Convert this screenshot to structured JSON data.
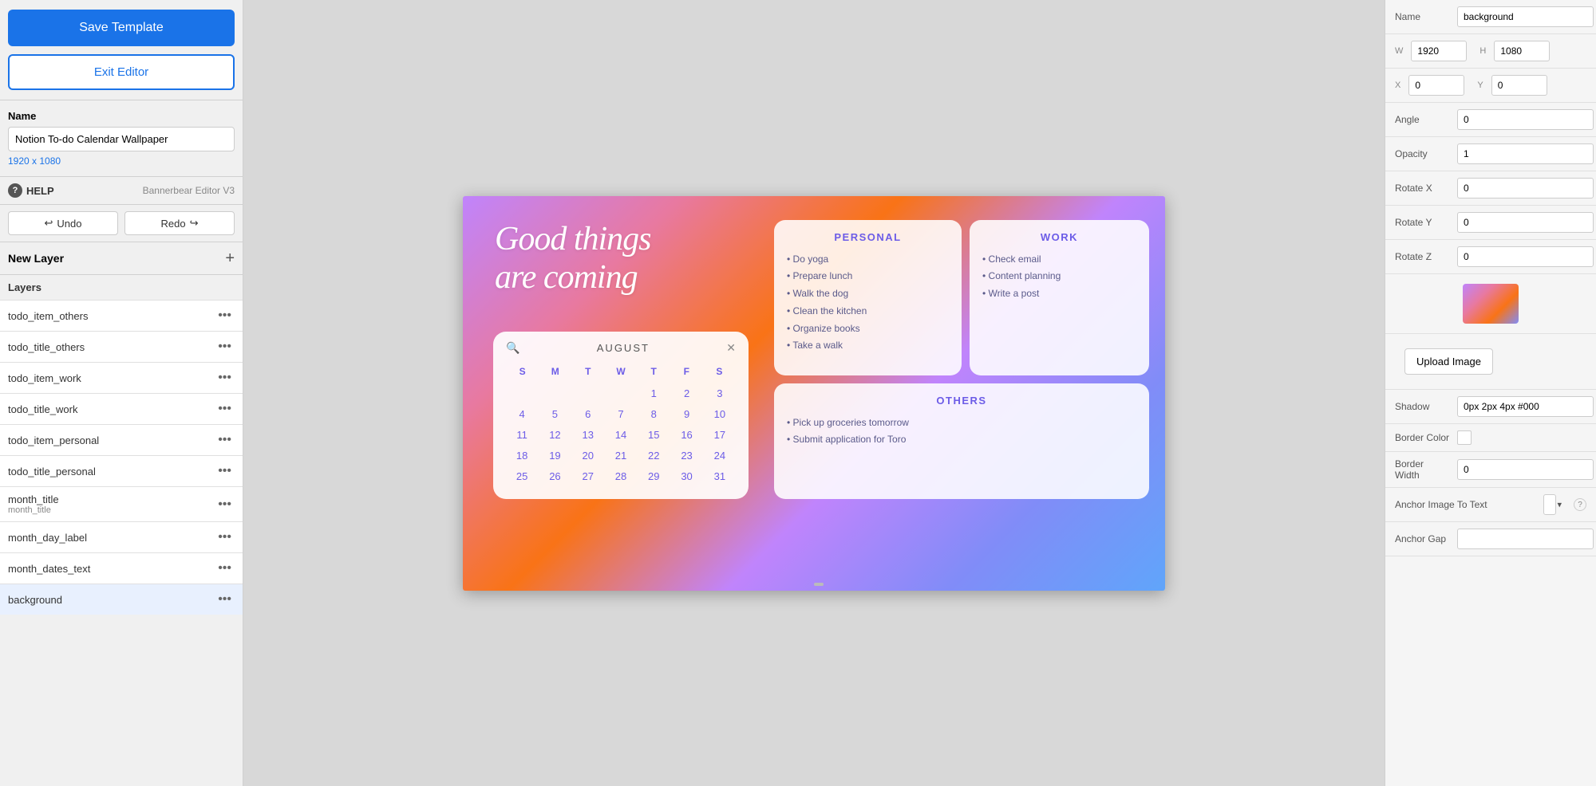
{
  "left_sidebar": {
    "save_template_label": "Save Template",
    "exit_editor_label": "Exit Editor",
    "name_label": "Name",
    "name_value": "Notion To-do Calendar Wallpaper",
    "dimensions": "1920 x 1080",
    "help_label": "HELP",
    "editor_version": "Bannerbear Editor V3",
    "undo_label": "Undo",
    "redo_label": "Redo",
    "new_layer_label": "New Layer",
    "layers_header": "Layers",
    "layers": [
      {
        "name": "todo_item_others",
        "sub": ""
      },
      {
        "name": "todo_title_others",
        "sub": ""
      },
      {
        "name": "todo_item_work",
        "sub": ""
      },
      {
        "name": "todo_title_work",
        "sub": ""
      },
      {
        "name": "todo_item_personal",
        "sub": ""
      },
      {
        "name": "todo_title_personal",
        "sub": ""
      },
      {
        "name": "month_title",
        "sub": "month_title"
      },
      {
        "name": "month_day_label",
        "sub": ""
      },
      {
        "name": "month_dates_text",
        "sub": ""
      },
      {
        "name": "background",
        "sub": ""
      }
    ]
  },
  "canvas": {
    "good_things_line1": "Good things",
    "good_things_line2": "are coming",
    "calendar": {
      "month": "AUGUST",
      "days": [
        "S",
        "M",
        "T",
        "W",
        "T",
        "F",
        "S"
      ],
      "dates": [
        [
          "",
          "",
          "",
          "",
          "1",
          "2",
          "3"
        ],
        [
          "4",
          "5",
          "6",
          "7",
          "8",
          "9",
          "10"
        ],
        [
          "11",
          "12",
          "13",
          "14",
          "15",
          "16",
          "17"
        ],
        [
          "18",
          "19",
          "20",
          "21",
          "22",
          "23",
          "24"
        ],
        [
          "25",
          "26",
          "27",
          "28",
          "29",
          "30",
          "31"
        ]
      ]
    },
    "personal": {
      "title": "PERSONAL",
      "items": [
        "• Do yoga",
        "• Prepare lunch",
        "• Walk the dog",
        "• Clean the kitchen",
        "• Organize books",
        "• Take a walk"
      ]
    },
    "work": {
      "title": "WORK",
      "items": [
        "• Check email",
        "• Content planning",
        "• Write a post"
      ]
    },
    "others": {
      "title": "OTHERS",
      "items": [
        "• Pick up groceries tomorrow",
        "• Submit application for Toro"
      ]
    }
  },
  "right_sidebar": {
    "name_label": "Name",
    "name_value": "background",
    "w_label": "W",
    "w_value": "1920",
    "h_label": "H",
    "h_value": "1080",
    "x_label": "X",
    "x_value": "0",
    "y_label": "Y",
    "y_value": "0",
    "angle_label": "Angle",
    "angle_value": "0",
    "opacity_label": "Opacity",
    "opacity_value": "1",
    "rotate_x_label": "Rotate X",
    "rotate_x_value": "0",
    "rotate_y_label": "Rotate Y",
    "rotate_y_value": "0",
    "rotate_z_label": "Rotate Z",
    "rotate_z_value": "0",
    "upload_image_label": "Upload Image",
    "shadow_label": "Shadow",
    "shadow_value": "0px 2px 4px #000",
    "border_color_label": "Border Color",
    "border_width_label": "Border Width",
    "border_width_value": "0",
    "anchor_image_label": "Anchor Image To Text",
    "anchor_gap_label": "Anchor Gap"
  }
}
